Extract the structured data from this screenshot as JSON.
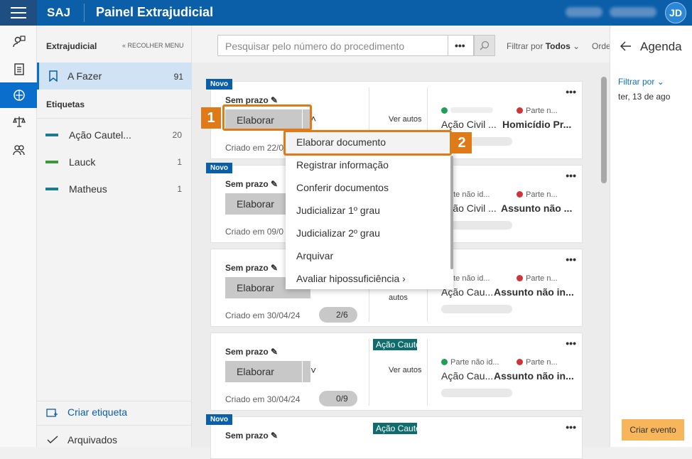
{
  "header": {
    "brand": "SAJ",
    "title": "Painel Extrajudicial",
    "user_initials": "JD"
  },
  "nav": {
    "header": "Extrajudicial",
    "collapse": "« RECOLHER MENU",
    "active_item": {
      "label": "A Fazer",
      "count": "91"
    },
    "section": "Etiquetas",
    "tags": [
      {
        "label": "Ação Cautel...",
        "count": "20",
        "color": "#1c7b8f"
      },
      {
        "label": "Lauck",
        "count": "1",
        "color": "#3a9a3a"
      },
      {
        "label": "Matheus",
        "count": "1",
        "color": "#1c7b8f"
      }
    ],
    "create_tag": "Criar etiqueta",
    "archived": "Arquivados"
  },
  "toolbar": {
    "search_placeholder": "Pesquisar pelo número do procedimento",
    "more": "•••",
    "filter_prefix": "Filtrar por",
    "filter_value": "Todos",
    "order": "Orde"
  },
  "cards": [
    {
      "novo": "Novo",
      "prazo": "Sem prazo",
      "action": "Elaborar",
      "created": "Criado em 22/0",
      "ver": "Ver autos",
      "party2": "Parte n...",
      "class": "Ação Civil ...",
      "subject": "Homicídio Pr..."
    },
    {
      "novo": "Novo",
      "prazo": "Sem prazo",
      "action": "Elaborar",
      "created": "Criado em 09/0",
      "party1": "Parte não id...",
      "party2": "Parte n...",
      "class": "Ação Civil ...",
      "subject": "Assunto não ..."
    },
    {
      "prazo": "Sem prazo",
      "action": "Elaborar",
      "created": "Criado em 30/04/24",
      "pill": "2/6",
      "ver": "autos",
      "party1": "Parte não id...",
      "party2": "Parte n...",
      "class": "Ação Cau...",
      "subject": "Assunto não in..."
    },
    {
      "prazo": "Sem prazo",
      "action": "Elaborar",
      "created": "Criado em 30/04/24",
      "pill": "0/9",
      "tag": "Ação Caute",
      "ver": "Ver autos",
      "party1": "Parte não id...",
      "party2": "Parte n...",
      "class": "Ação Cau...",
      "subject": "Assunto não in..."
    },
    {
      "novo": "Novo",
      "prazo": "Sem prazo",
      "tag": "Ação Caute"
    }
  ],
  "menu": {
    "items": [
      "Elaborar documento",
      "Registrar informação",
      "Conferir documentos",
      "Judicializar 1º grau",
      "Judicializar 2º grau",
      "Arquivar",
      "Avaliar hipossuficiência"
    ]
  },
  "badges": {
    "one": "1",
    "two": "2"
  },
  "agenda": {
    "title": "Agenda",
    "filter": "Filtrar por",
    "date": "ter, 13 de ago",
    "create": "Criar evento"
  },
  "colors": {
    "header": "#0a5fa8",
    "accent": "#0a6fcc",
    "highlight": "#e07a18",
    "tag": "#0e6c6c"
  }
}
